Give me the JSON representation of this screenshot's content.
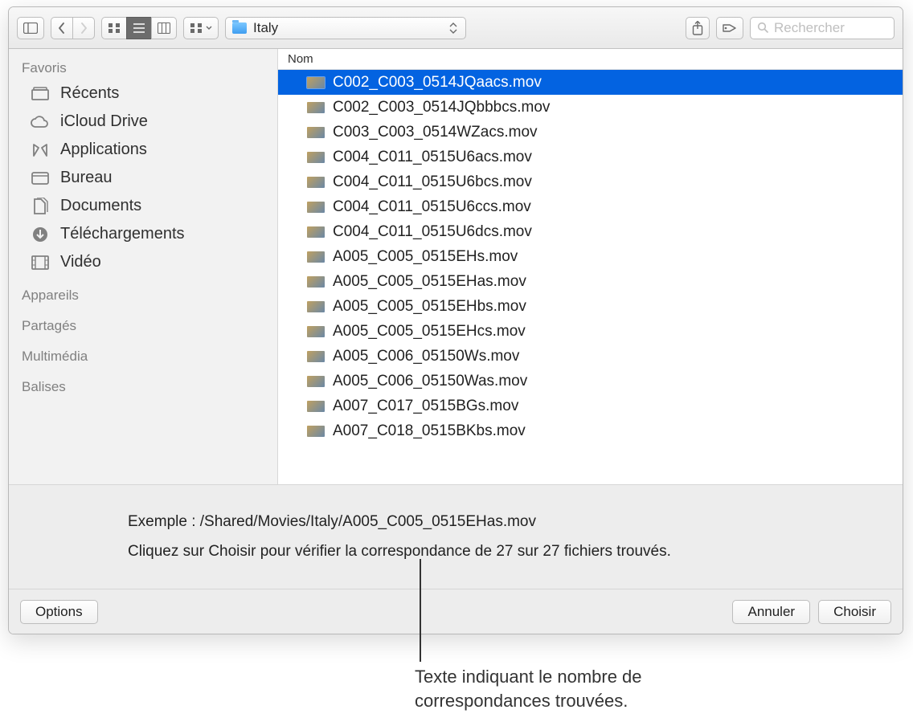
{
  "toolbar": {
    "path_label": "Italy",
    "search_placeholder": "Rechercher"
  },
  "sidebar": {
    "headers": [
      "Favoris",
      "Appareils",
      "Partagés",
      "Multimédia",
      "Balises"
    ],
    "favorites": [
      {
        "label": "Récents"
      },
      {
        "label": "iCloud Drive"
      },
      {
        "label": "Applications"
      },
      {
        "label": "Bureau"
      },
      {
        "label": "Documents"
      },
      {
        "label": "Téléchargements"
      },
      {
        "label": "Vidéo"
      }
    ]
  },
  "list": {
    "column_header": "Nom",
    "files": [
      "C002_C003_0514JQaacs.mov",
      "C002_C003_0514JQbbbcs.mov",
      "C003_C003_0514WZacs.mov",
      "C004_C011_0515U6acs.mov",
      "C004_C011_0515U6bcs.mov",
      "C004_C011_0515U6ccs.mov",
      "C004_C011_0515U6dcs.mov",
      "A005_C005_0515EHs.mov",
      "A005_C005_0515EHas.mov",
      "A005_C005_0515EHbs.mov",
      "A005_C005_0515EHcs.mov",
      "A005_C006_05150Ws.mov",
      "A005_C006_05150Was.mov",
      "A007_C017_0515BGs.mov",
      "A007_C018_0515BKbs.mov"
    ],
    "selected_index": 0
  },
  "info": {
    "example_line": "Exemple : /Shared/Movies/Italy/A005_C005_0515EHas.mov",
    "match_line": "Cliquez sur Choisir pour vérifier la correspondance de 27 sur 27 fichiers trouvés."
  },
  "buttons": {
    "options": "Options",
    "cancel": "Annuler",
    "choose": "Choisir"
  },
  "callout": "Texte indiquant le nombre de correspondances trouvées."
}
